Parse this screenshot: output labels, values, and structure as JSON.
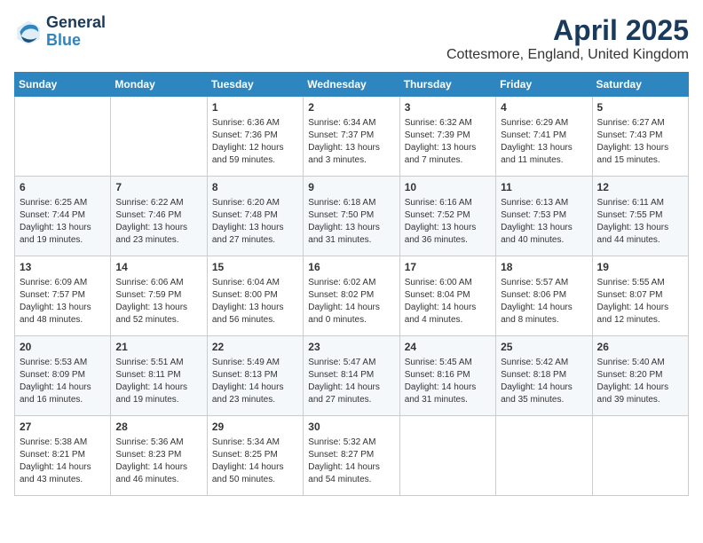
{
  "logo": {
    "line1": "General",
    "line2": "Blue"
  },
  "title": "April 2025",
  "subtitle": "Cottesmore, England, United Kingdom",
  "days_of_week": [
    "Sunday",
    "Monday",
    "Tuesday",
    "Wednesday",
    "Thursday",
    "Friday",
    "Saturday"
  ],
  "weeks": [
    [
      {
        "day": "",
        "info": ""
      },
      {
        "day": "",
        "info": ""
      },
      {
        "day": "1",
        "info": "Sunrise: 6:36 AM\nSunset: 7:36 PM\nDaylight: 12 hours and 59 minutes."
      },
      {
        "day": "2",
        "info": "Sunrise: 6:34 AM\nSunset: 7:37 PM\nDaylight: 13 hours and 3 minutes."
      },
      {
        "day": "3",
        "info": "Sunrise: 6:32 AM\nSunset: 7:39 PM\nDaylight: 13 hours and 7 minutes."
      },
      {
        "day": "4",
        "info": "Sunrise: 6:29 AM\nSunset: 7:41 PM\nDaylight: 13 hours and 11 minutes."
      },
      {
        "day": "5",
        "info": "Sunrise: 6:27 AM\nSunset: 7:43 PM\nDaylight: 13 hours and 15 minutes."
      }
    ],
    [
      {
        "day": "6",
        "info": "Sunrise: 6:25 AM\nSunset: 7:44 PM\nDaylight: 13 hours and 19 minutes."
      },
      {
        "day": "7",
        "info": "Sunrise: 6:22 AM\nSunset: 7:46 PM\nDaylight: 13 hours and 23 minutes."
      },
      {
        "day": "8",
        "info": "Sunrise: 6:20 AM\nSunset: 7:48 PM\nDaylight: 13 hours and 27 minutes."
      },
      {
        "day": "9",
        "info": "Sunrise: 6:18 AM\nSunset: 7:50 PM\nDaylight: 13 hours and 31 minutes."
      },
      {
        "day": "10",
        "info": "Sunrise: 6:16 AM\nSunset: 7:52 PM\nDaylight: 13 hours and 36 minutes."
      },
      {
        "day": "11",
        "info": "Sunrise: 6:13 AM\nSunset: 7:53 PM\nDaylight: 13 hours and 40 minutes."
      },
      {
        "day": "12",
        "info": "Sunrise: 6:11 AM\nSunset: 7:55 PM\nDaylight: 13 hours and 44 minutes."
      }
    ],
    [
      {
        "day": "13",
        "info": "Sunrise: 6:09 AM\nSunset: 7:57 PM\nDaylight: 13 hours and 48 minutes."
      },
      {
        "day": "14",
        "info": "Sunrise: 6:06 AM\nSunset: 7:59 PM\nDaylight: 13 hours and 52 minutes."
      },
      {
        "day": "15",
        "info": "Sunrise: 6:04 AM\nSunset: 8:00 PM\nDaylight: 13 hours and 56 minutes."
      },
      {
        "day": "16",
        "info": "Sunrise: 6:02 AM\nSunset: 8:02 PM\nDaylight: 14 hours and 0 minutes."
      },
      {
        "day": "17",
        "info": "Sunrise: 6:00 AM\nSunset: 8:04 PM\nDaylight: 14 hours and 4 minutes."
      },
      {
        "day": "18",
        "info": "Sunrise: 5:57 AM\nSunset: 8:06 PM\nDaylight: 14 hours and 8 minutes."
      },
      {
        "day": "19",
        "info": "Sunrise: 5:55 AM\nSunset: 8:07 PM\nDaylight: 14 hours and 12 minutes."
      }
    ],
    [
      {
        "day": "20",
        "info": "Sunrise: 5:53 AM\nSunset: 8:09 PM\nDaylight: 14 hours and 16 minutes."
      },
      {
        "day": "21",
        "info": "Sunrise: 5:51 AM\nSunset: 8:11 PM\nDaylight: 14 hours and 19 minutes."
      },
      {
        "day": "22",
        "info": "Sunrise: 5:49 AM\nSunset: 8:13 PM\nDaylight: 14 hours and 23 minutes."
      },
      {
        "day": "23",
        "info": "Sunrise: 5:47 AM\nSunset: 8:14 PM\nDaylight: 14 hours and 27 minutes."
      },
      {
        "day": "24",
        "info": "Sunrise: 5:45 AM\nSunset: 8:16 PM\nDaylight: 14 hours and 31 minutes."
      },
      {
        "day": "25",
        "info": "Sunrise: 5:42 AM\nSunset: 8:18 PM\nDaylight: 14 hours and 35 minutes."
      },
      {
        "day": "26",
        "info": "Sunrise: 5:40 AM\nSunset: 8:20 PM\nDaylight: 14 hours and 39 minutes."
      }
    ],
    [
      {
        "day": "27",
        "info": "Sunrise: 5:38 AM\nSunset: 8:21 PM\nDaylight: 14 hours and 43 minutes."
      },
      {
        "day": "28",
        "info": "Sunrise: 5:36 AM\nSunset: 8:23 PM\nDaylight: 14 hours and 46 minutes."
      },
      {
        "day": "29",
        "info": "Sunrise: 5:34 AM\nSunset: 8:25 PM\nDaylight: 14 hours and 50 minutes."
      },
      {
        "day": "30",
        "info": "Sunrise: 5:32 AM\nSunset: 8:27 PM\nDaylight: 14 hours and 54 minutes."
      },
      {
        "day": "",
        "info": ""
      },
      {
        "day": "",
        "info": ""
      },
      {
        "day": "",
        "info": ""
      }
    ]
  ]
}
